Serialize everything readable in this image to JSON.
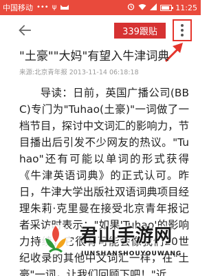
{
  "status_bar": {
    "carrier": "中国移动",
    "time": "11:25",
    "background": "#e94a3c"
  },
  "app_bar": {
    "comment_badge": "339跟贴",
    "badge_color": "#d63232",
    "highlight_color": "#e5342b"
  },
  "article": {
    "headline": "\"土豪\"\"大妈\"有望入牛津词典",
    "meta": "来源:北京青年报 2013-11-14 06:18:18",
    "body": "导读：日前，英国广播公司(BBC)专门为\"Tuhao(土豪)\"一词做了一档节目，探讨中文词汇的影响力，节目播出后引发不少网友的热议。\"Tuhao\"还有可能以单词的形式获得《牛津英语词典》的正式认可。昨日，牛津大学出版社双语词典项目经理朱莉·克里曼在接受北京青年报记者采访时表示：\"如果'Tuhao'的影响力持续，它很有可能会像我们20世纪收录的其他中文词汇一样，在\"土豪\"一词，让我们回顾下吧！\"近"
  },
  "watermark": {
    "title": "君山手游网",
    "subtitle": "JUNSHANSHOUYOUWANG"
  }
}
